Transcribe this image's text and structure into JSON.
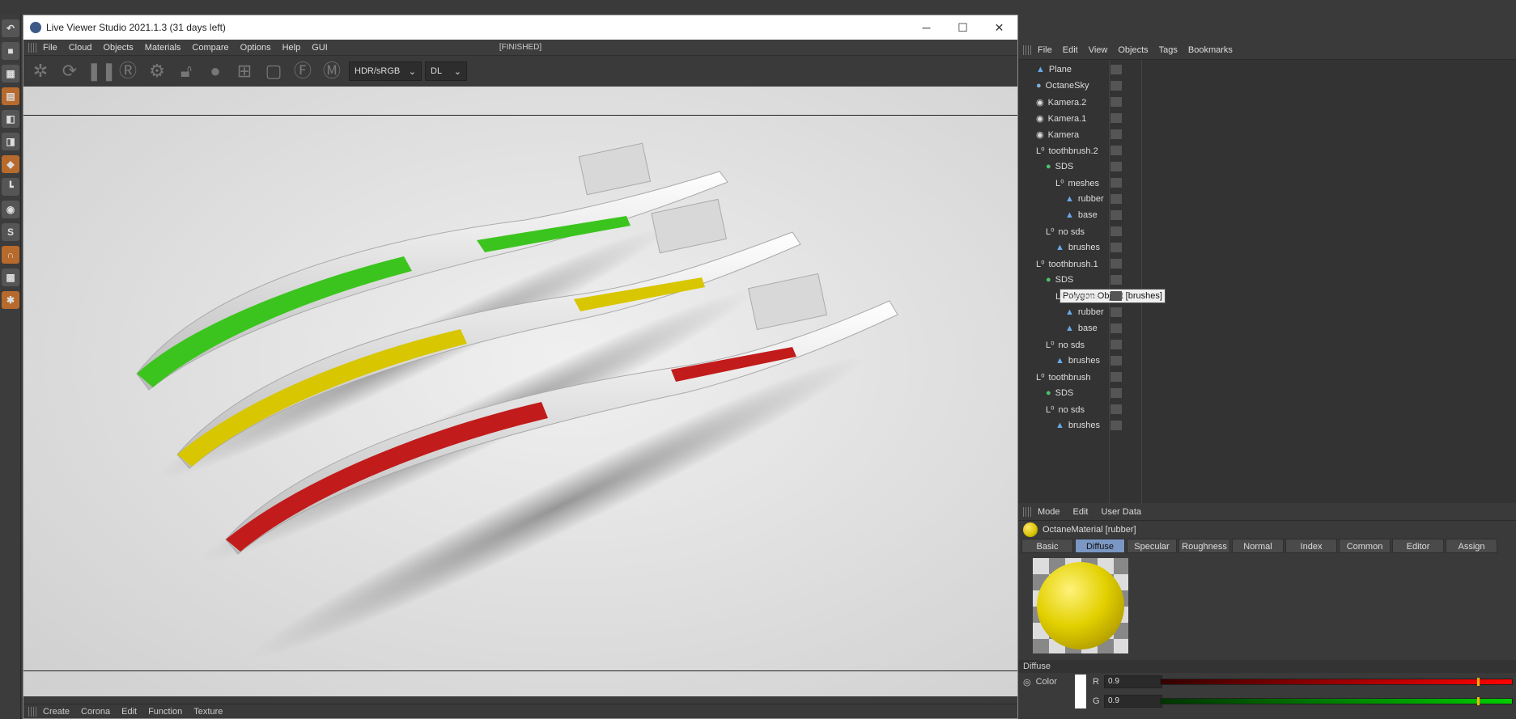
{
  "window": {
    "title": "Live Viewer Studio 2021.1.3 (31 days left)",
    "status": "[FINISHED]"
  },
  "lv_menu": [
    "File",
    "Cloud",
    "Objects",
    "Materials",
    "Compare",
    "Options",
    "Help",
    "GUI"
  ],
  "lv_toolbar": {
    "colorspace": "HDR/sRGB",
    "kernel": "DL"
  },
  "lv_bottom_menu": [
    "Create",
    "Corona",
    "Edit",
    "Function",
    "Texture"
  ],
  "om_menu": [
    "File",
    "Edit",
    "View",
    "Objects",
    "Tags",
    "Bookmarks"
  ],
  "objects": [
    {
      "name": "Plane",
      "indent": 0,
      "type": "poly"
    },
    {
      "name": "OctaneSky",
      "indent": 0,
      "type": "sky"
    },
    {
      "name": "Kamera.2",
      "indent": 0,
      "type": "cam"
    },
    {
      "name": "Kamera.1",
      "indent": 0,
      "type": "cam"
    },
    {
      "name": "Kamera",
      "indent": 0,
      "type": "cam"
    },
    {
      "name": "toothbrush.2",
      "indent": 0,
      "type": "null"
    },
    {
      "name": "SDS",
      "indent": 1,
      "type": "sds"
    },
    {
      "name": "meshes",
      "indent": 2,
      "type": "null"
    },
    {
      "name": "rubber",
      "indent": 3,
      "type": "poly"
    },
    {
      "name": "base",
      "indent": 3,
      "type": "poly"
    },
    {
      "name": "no sds",
      "indent": 1,
      "type": "null"
    },
    {
      "name": "brushes",
      "indent": 2,
      "type": "poly"
    },
    {
      "name": "toothbrush.1",
      "indent": 0,
      "type": "null"
    },
    {
      "name": "SDS",
      "indent": 1,
      "type": "sds"
    },
    {
      "name": "meshes",
      "indent": 2,
      "type": "null"
    },
    {
      "name": "rubber",
      "indent": 3,
      "type": "poly"
    },
    {
      "name": "base",
      "indent": 3,
      "type": "poly"
    },
    {
      "name": "no sds",
      "indent": 1,
      "type": "null"
    },
    {
      "name": "brushes",
      "indent": 2,
      "type": "poly"
    },
    {
      "name": "toothbrush",
      "indent": 0,
      "type": "null"
    },
    {
      "name": "SDS",
      "indent": 1,
      "type": "sds"
    },
    {
      "name": "no sds",
      "indent": 1,
      "type": "null"
    },
    {
      "name": "brushes",
      "indent": 2,
      "type": "poly"
    }
  ],
  "tooltip": "Polygon Object [brushes]",
  "am_menu": [
    "Mode",
    "Edit",
    "User Data"
  ],
  "material_title": "OctaneMaterial [rubber]",
  "am_tabs": [
    "Basic",
    "Diffuse",
    "Specular",
    "Roughness",
    "Normal",
    "Index",
    "Common",
    "Editor",
    "Assign"
  ],
  "active_tab": "Diffuse",
  "section": "Diffuse",
  "color_label": "Color",
  "channels": [
    {
      "label": "R",
      "value": "0.9"
    },
    {
      "label": "G",
      "value": "0.9"
    }
  ],
  "colors": {
    "green": "#3cc41e",
    "yellow": "#d8c600",
    "red": "#c21b1b"
  }
}
